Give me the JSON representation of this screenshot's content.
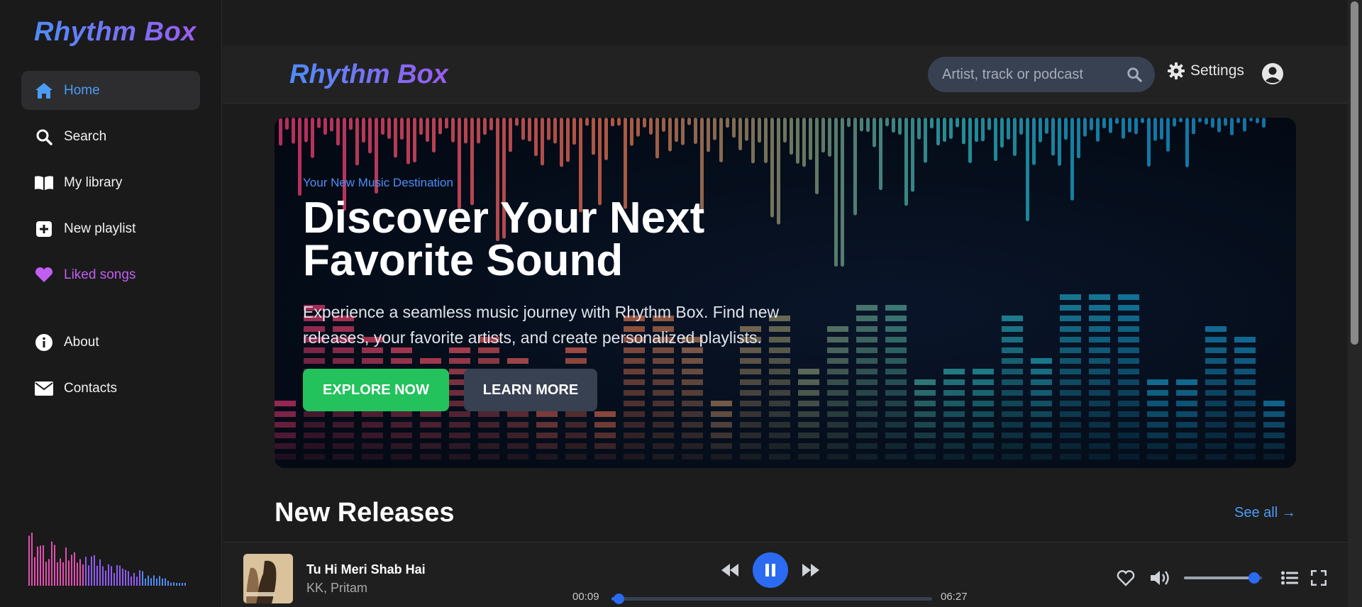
{
  "app": {
    "title": "Rhythm Box"
  },
  "sidebar": {
    "logo": "Rhythm Box",
    "items": [
      {
        "label": "Home",
        "icon": "home-icon",
        "active": true
      },
      {
        "label": "Search",
        "icon": "search-icon"
      },
      {
        "label": "My library",
        "icon": "book-icon"
      },
      {
        "label": "New playlist",
        "icon": "plus-square-icon"
      },
      {
        "label": "Liked songs",
        "icon": "heart-icon"
      },
      {
        "label": "About",
        "icon": "info-icon"
      },
      {
        "label": "Contacts",
        "icon": "envelope-icon"
      }
    ]
  },
  "header": {
    "logo": "Rhythm Box",
    "search_placeholder": "Artist, track or podcast",
    "settings_label": "Settings"
  },
  "hero": {
    "subtitle": "Your New Music Destination",
    "title": "Discover Your Next Favorite Sound",
    "description": "Experience a seamless music journey with Rhythm Box. Find new releases, your favorite artists, and create personalized playlists.",
    "explore_label": "EXPLORE NOW",
    "learn_label": "LEARN MORE"
  },
  "releases": {
    "title": "New Releases",
    "see_all": "See all →"
  },
  "player": {
    "track": "Tu Hi Meri Shab Hai",
    "artist": "KK, Pritam",
    "elapsed": "00:09",
    "duration": "06:27",
    "progress": 0.023,
    "volume": 0.9
  },
  "colors": {
    "accent": "#2a6bf2",
    "link": "#4c9bf5",
    "explore": "#24c25c",
    "liked": "#c25ef2"
  }
}
